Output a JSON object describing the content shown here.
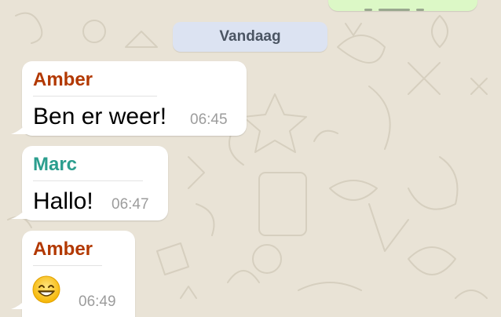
{
  "chat": {
    "date_label": "Vandaag",
    "messages": [
      {
        "sender": "Amber",
        "sender_color": "#b23800",
        "text": "Ben er weer!",
        "time": "06:45"
      },
      {
        "sender": "Marc",
        "sender_color": "#2b9e8e",
        "text": "Hallo!",
        "time": "06:47"
      },
      {
        "sender": "Amber",
        "sender_color": "#b23800",
        "emoji": "grinning-face-icon",
        "time": "06:49"
      }
    ]
  },
  "colors": {
    "wallpaper": "#e9e3d6",
    "outgoing_bubble": "#dcf8c6",
    "incoming_bubble": "#ffffff",
    "date_pill": "#dce3f2"
  }
}
